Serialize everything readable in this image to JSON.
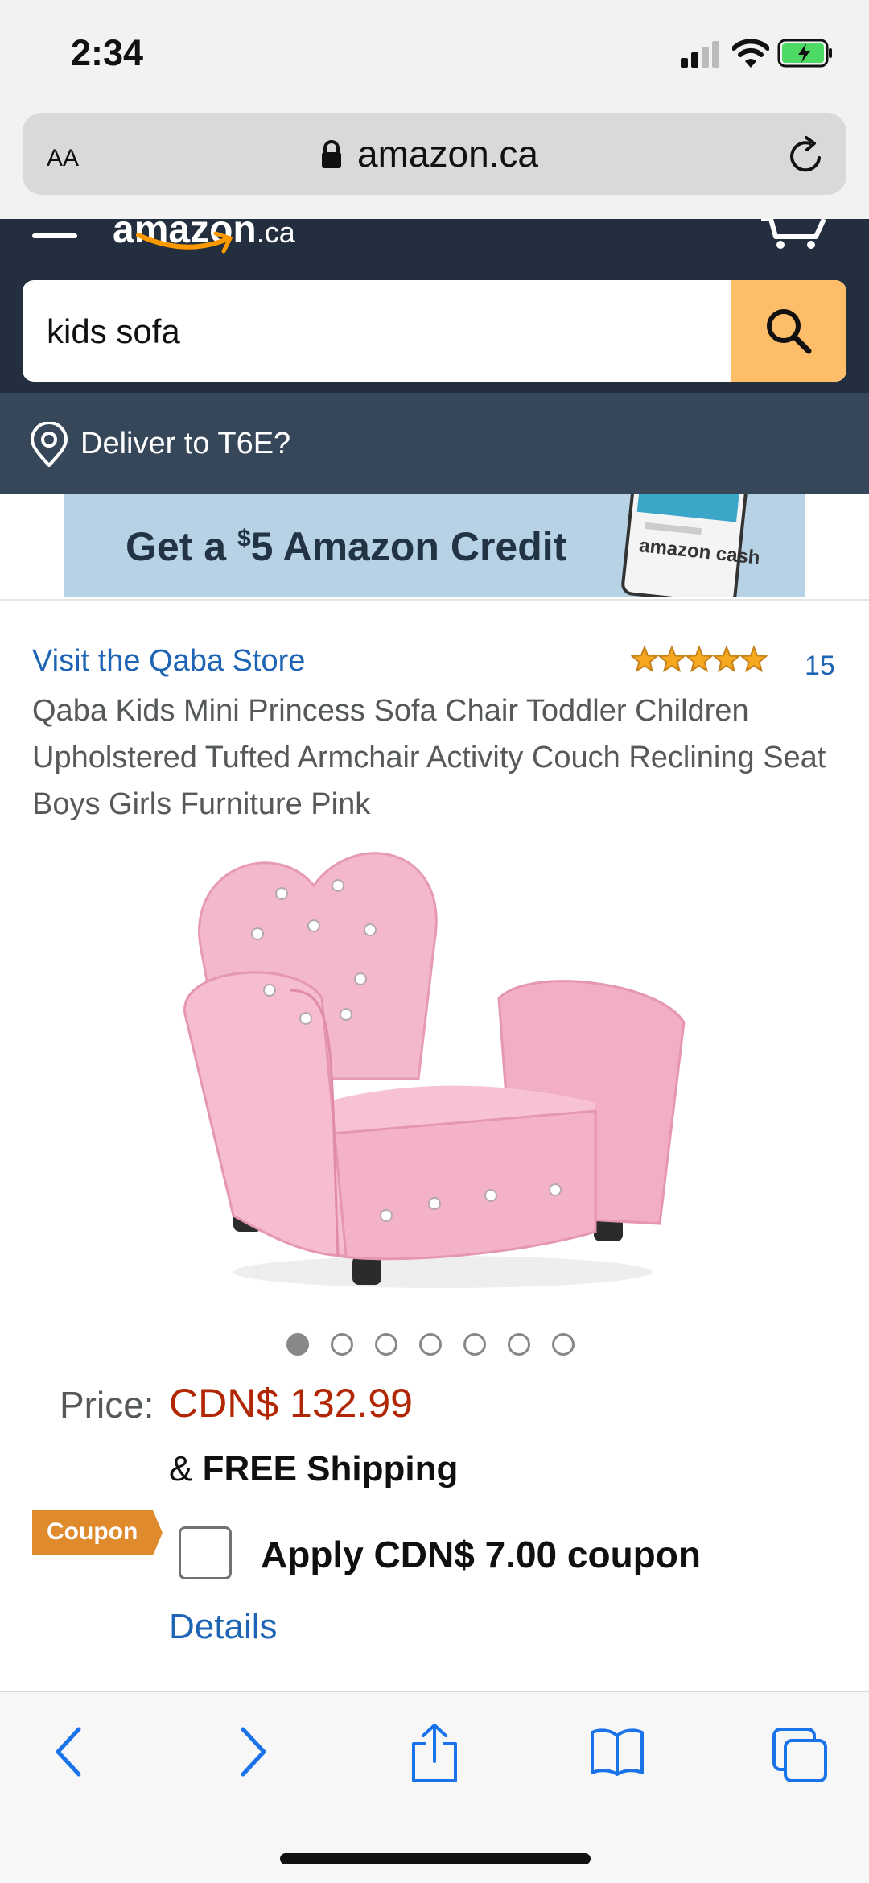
{
  "status_bar": {
    "time": "2:34"
  },
  "browser": {
    "text_size_label": "AA",
    "domain": "amazon.ca"
  },
  "amazon_header": {
    "logo_text": "amazon",
    "logo_suffix": ".ca",
    "search_query": "kids sofa"
  },
  "deliver": {
    "text": "Deliver to T6E?"
  },
  "banner": {
    "text_prefix": "Get a ",
    "text_super": "$",
    "text_rest": "5 Amazon Credit",
    "phone_label": "amazon cash"
  },
  "product": {
    "store_link": "Visit the Qaba Store",
    "rating": 5,
    "rating_count": "15",
    "title": "Qaba Kids Mini Princess Sofa Chair Toddler Children Upholstered Tufted Armchair Activity Couch Reclining Seat Boys Girls Furniture Pink",
    "image_count": 7,
    "active_image": 0,
    "price_label": "Price:",
    "price": "CDN$ 132.99",
    "shipping_prefix": "& ",
    "shipping_bold": "FREE Shipping",
    "coupon_tag": "Coupon",
    "coupon_text": "Apply CDN$ 7.00 coupon",
    "details_link": "Details"
  },
  "colors": {
    "header_bg": "#232f3e",
    "deliver_bg": "#37475a",
    "search_button": "#febd69",
    "link": "#1e64b4",
    "price": "#b12704",
    "coupon_tag": "#e08a2e"
  },
  "toolbar": {
    "icons": [
      "back-icon",
      "forward-icon",
      "share-icon",
      "bookmarks-icon",
      "tabs-icon"
    ]
  }
}
